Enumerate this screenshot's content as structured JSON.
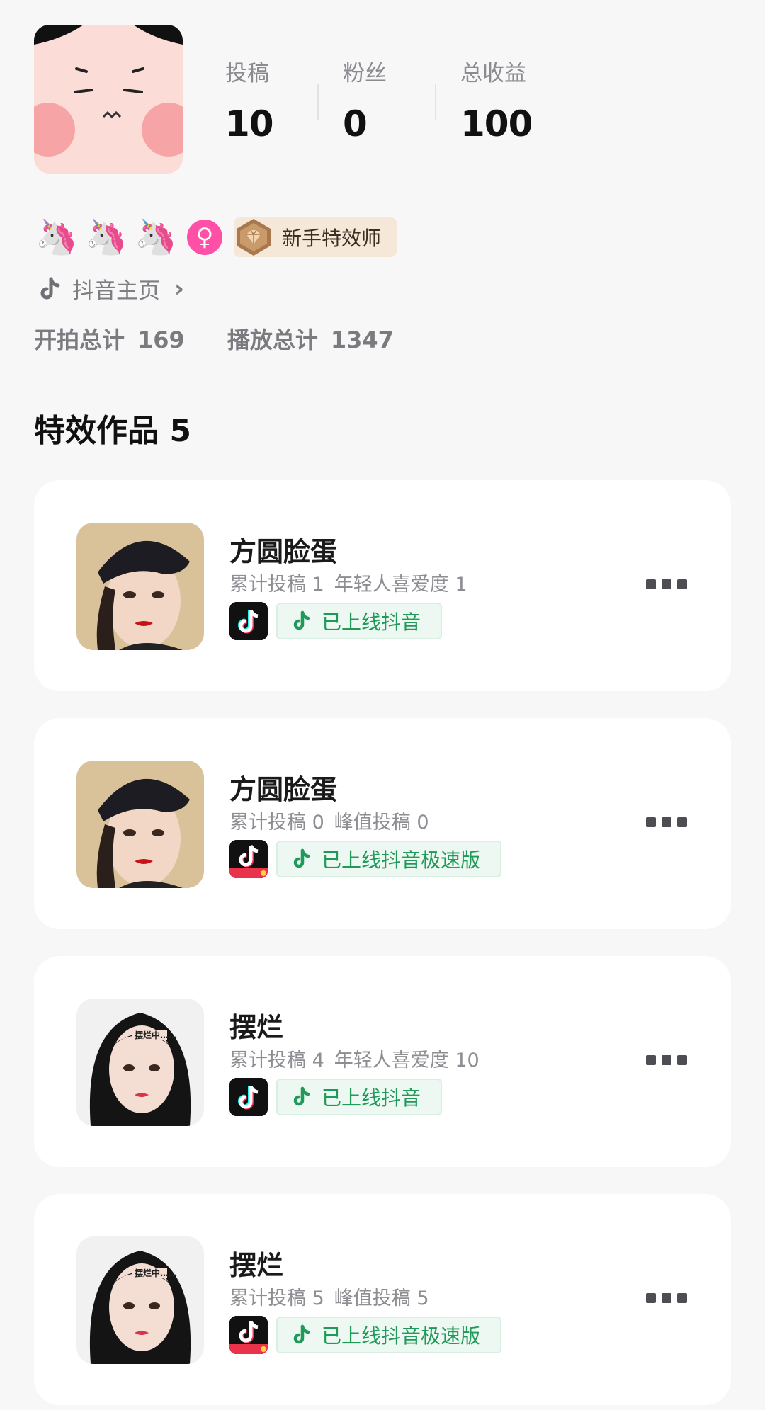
{
  "profile": {
    "stats": [
      {
        "label": "投稿",
        "value": "10"
      },
      {
        "label": "粉丝",
        "value": "0"
      },
      {
        "label": "总收益",
        "value": "100"
      }
    ],
    "badge_text": "新手特效师",
    "douyin_link": "抖音主页",
    "totals": [
      {
        "label": "开拍总计",
        "value": "169"
      },
      {
        "label": "播放总计",
        "value": "1347"
      }
    ]
  },
  "section": {
    "title": "特效作品 5"
  },
  "cards": [
    {
      "title": "方圆脸蛋",
      "meta1": "累计投稿 1",
      "meta2": "年轻人喜爱度 1",
      "tag": "已上线抖音",
      "app": "douyin"
    },
    {
      "title": "方圆脸蛋",
      "meta1": "累计投稿 0",
      "meta2": "峰值投稿 0",
      "tag": "已上线抖音极速版",
      "app": "douyin-lite"
    },
    {
      "title": "摆烂",
      "meta1": "累计投稿 4",
      "meta2": "年轻人喜爱度 10",
      "tag": "已上线抖音",
      "app": "douyin"
    },
    {
      "title": "摆烂",
      "meta1": "累计投稿 5",
      "meta2": "峰值投稿 5",
      "tag": "已上线抖音极速版",
      "app": "douyin-lite"
    }
  ],
  "icons": {
    "gender": "female-icon",
    "badge": "gem-medal-icon",
    "more": "more-dots-icon"
  },
  "colors": {
    "accent_green": "#1f9a58",
    "gender_pink": "#ff4fa6"
  }
}
